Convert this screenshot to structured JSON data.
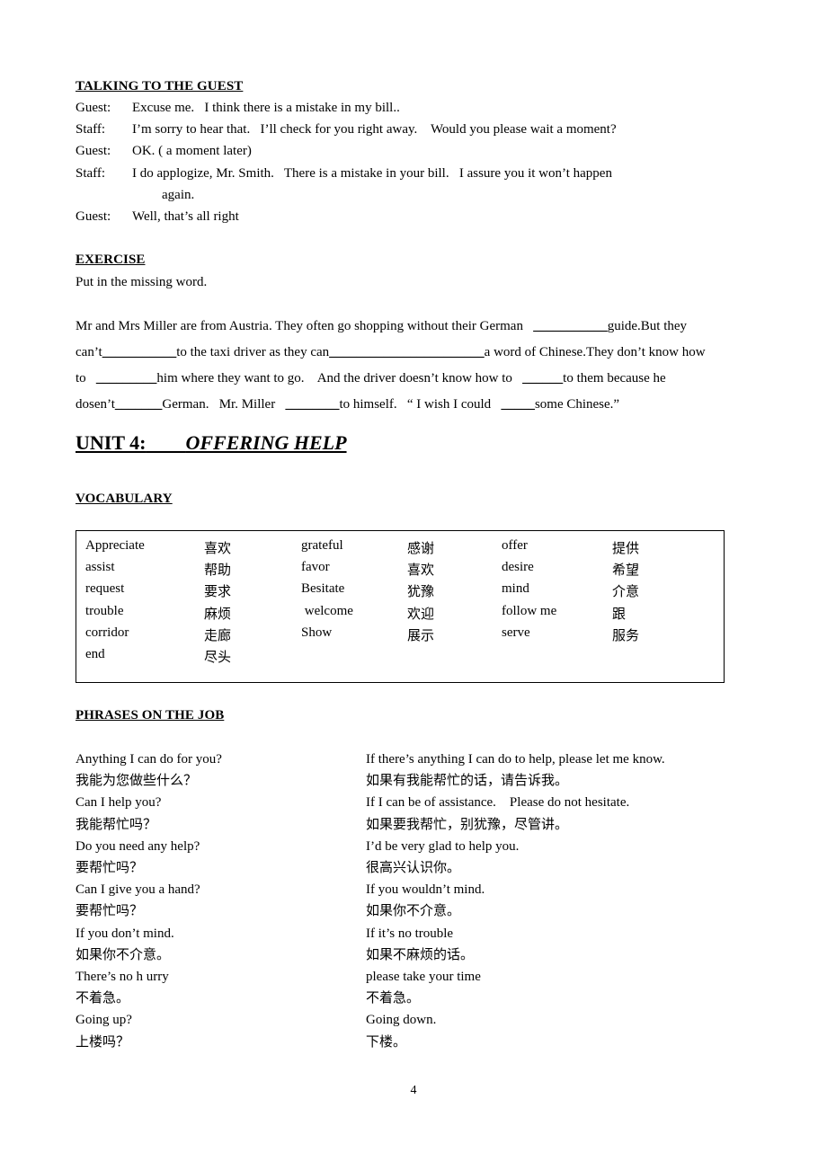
{
  "dialogue_section": {
    "heading": "TALKING TO THE GUEST",
    "lines": [
      {
        "speaker": "Guest:",
        "text": "Excuse me.   I think there is a mistake in my bill.."
      },
      {
        "speaker": "Staff:",
        "text": "I’m sorry to hear that.   I’ll check for you right away.    Would you please wait a moment?"
      },
      {
        "speaker": "Guest:",
        "text": "OK. ( a moment later)"
      },
      {
        "speaker": "Staff:",
        "text": "I do applogize, Mr. Smith.   There is a mistake in your bill.   I assure you it won’t happen"
      },
      {
        "speaker": "",
        "text": "again.",
        "continuation": true
      },
      {
        "speaker": "Guest:",
        "text": "Well, that’s all right"
      }
    ]
  },
  "exercise_section": {
    "heading": "EXERCISE",
    "instruction": "Put in the missing word.",
    "paragraph_lines": [
      [
        {
          "t": "Mr and Mrs Miller are from Austria. They often go shopping without their German   ",
          "blank": false
        },
        {
          "t": "___________",
          "blank": true
        },
        {
          "t": "guide.But they",
          "blank": false
        }
      ],
      [
        {
          "t": "can’t",
          "blank": false
        },
        {
          "t": "___________",
          "blank": true
        },
        {
          "t": "to the taxi driver as they can",
          "blank": false
        },
        {
          "t": "_______________________",
          "blank": true
        },
        {
          "t": "a word of Chinese.They don’t know how",
          "blank": false
        }
      ],
      [
        {
          "t": "to   ",
          "blank": false
        },
        {
          "t": "_________",
          "blank": true
        },
        {
          "t": "him where they want to go.    And the driver doesn’t know how to   ",
          "blank": false
        },
        {
          "t": "______",
          "blank": true
        },
        {
          "t": "to them because he",
          "blank": false
        }
      ],
      [
        {
          "t": "dosen’t",
          "blank": false
        },
        {
          "t": "_______",
          "blank": true
        },
        {
          "t": "German.   Mr. Miller   ",
          "blank": false
        },
        {
          "t": "________",
          "blank": true
        },
        {
          "t": "to himself.   “ I wish I could   ",
          "blank": false
        },
        {
          "t": "_____",
          "blank": true
        },
        {
          "t": "some Chinese.”",
          "blank": false
        }
      ]
    ]
  },
  "unit": {
    "label": "UNIT 4:",
    "spacer": "        ",
    "title": "OFFERING HELP"
  },
  "vocabulary_section": {
    "heading": "VOCABULARY",
    "rows": [
      {
        "en1": "Appreciate",
        "zh1": "喜欢",
        "en2": "grateful",
        "zh2": "感谢",
        "en3": "offer",
        "zh3": "提供"
      },
      {
        "en1": "assist",
        "zh1": "帮助",
        "en2": "favor",
        "zh2": "喜欢",
        "en3": "desire",
        "zh3": "希望"
      },
      {
        "en1": "request",
        "zh1": "要求",
        "en2": "Besitate",
        "zh2": "犹豫",
        "en3": "mind",
        "zh3": "介意"
      },
      {
        "en1": "trouble",
        "zh1": "麻烦",
        "en2": " welcome",
        "zh2": "欢迎",
        "en3": "follow me",
        "zh3": "跟"
      },
      {
        "en1": "corridor",
        "zh1": "走廊",
        "en2": "Show",
        "zh2": "展示",
        "en3": "serve",
        "zh3": "服务"
      },
      {
        "en1": "end",
        "zh1": "尽头",
        "en2": "",
        "zh2": "",
        "en3": "",
        "zh3": ""
      }
    ]
  },
  "phrases_section": {
    "heading": "PHRASES ON THE JOB",
    "rows": [
      {
        "left": "Anything I can do for you?",
        "right": "If there’s anything I can do to help, please let me know."
      },
      {
        "left": "我能为您做些什么？",
        "right": "如果有我能帮忙的话，请告诉我。"
      },
      {
        "left": "Can I help you?",
        "right": "If I can be of assistance.    Please do not hesitate."
      },
      {
        "left": "我能帮忙吗？",
        "right": "如果要我帮忙，别犹豫，尽管讲。"
      },
      {
        "left": "Do you need any help?",
        "right": "I’d be very glad to help you."
      },
      {
        "left": "要帮忙吗？",
        "right": "很高兴认识你。"
      },
      {
        "left": "Can I give you a hand?",
        "right": "If you wouldn’t mind."
      },
      {
        "left": "要帮忙吗？",
        "right": "如果你不介意。"
      },
      {
        "left": "If you don’t mind.",
        "right": "If it’s no trouble"
      },
      {
        "left": "如果你不介意。",
        "right": "如果不麻烦的话。"
      },
      {
        "left": "There’s no h urry",
        "right": "please take your time"
      },
      {
        "left": "不着急。",
        "right": "不着急。"
      },
      {
        "left": "Going up?",
        "right": "Going down."
      },
      {
        "left": "上楼吗？",
        "right": "下楼。"
      }
    ]
  },
  "footer": {
    "page_number": "4"
  }
}
